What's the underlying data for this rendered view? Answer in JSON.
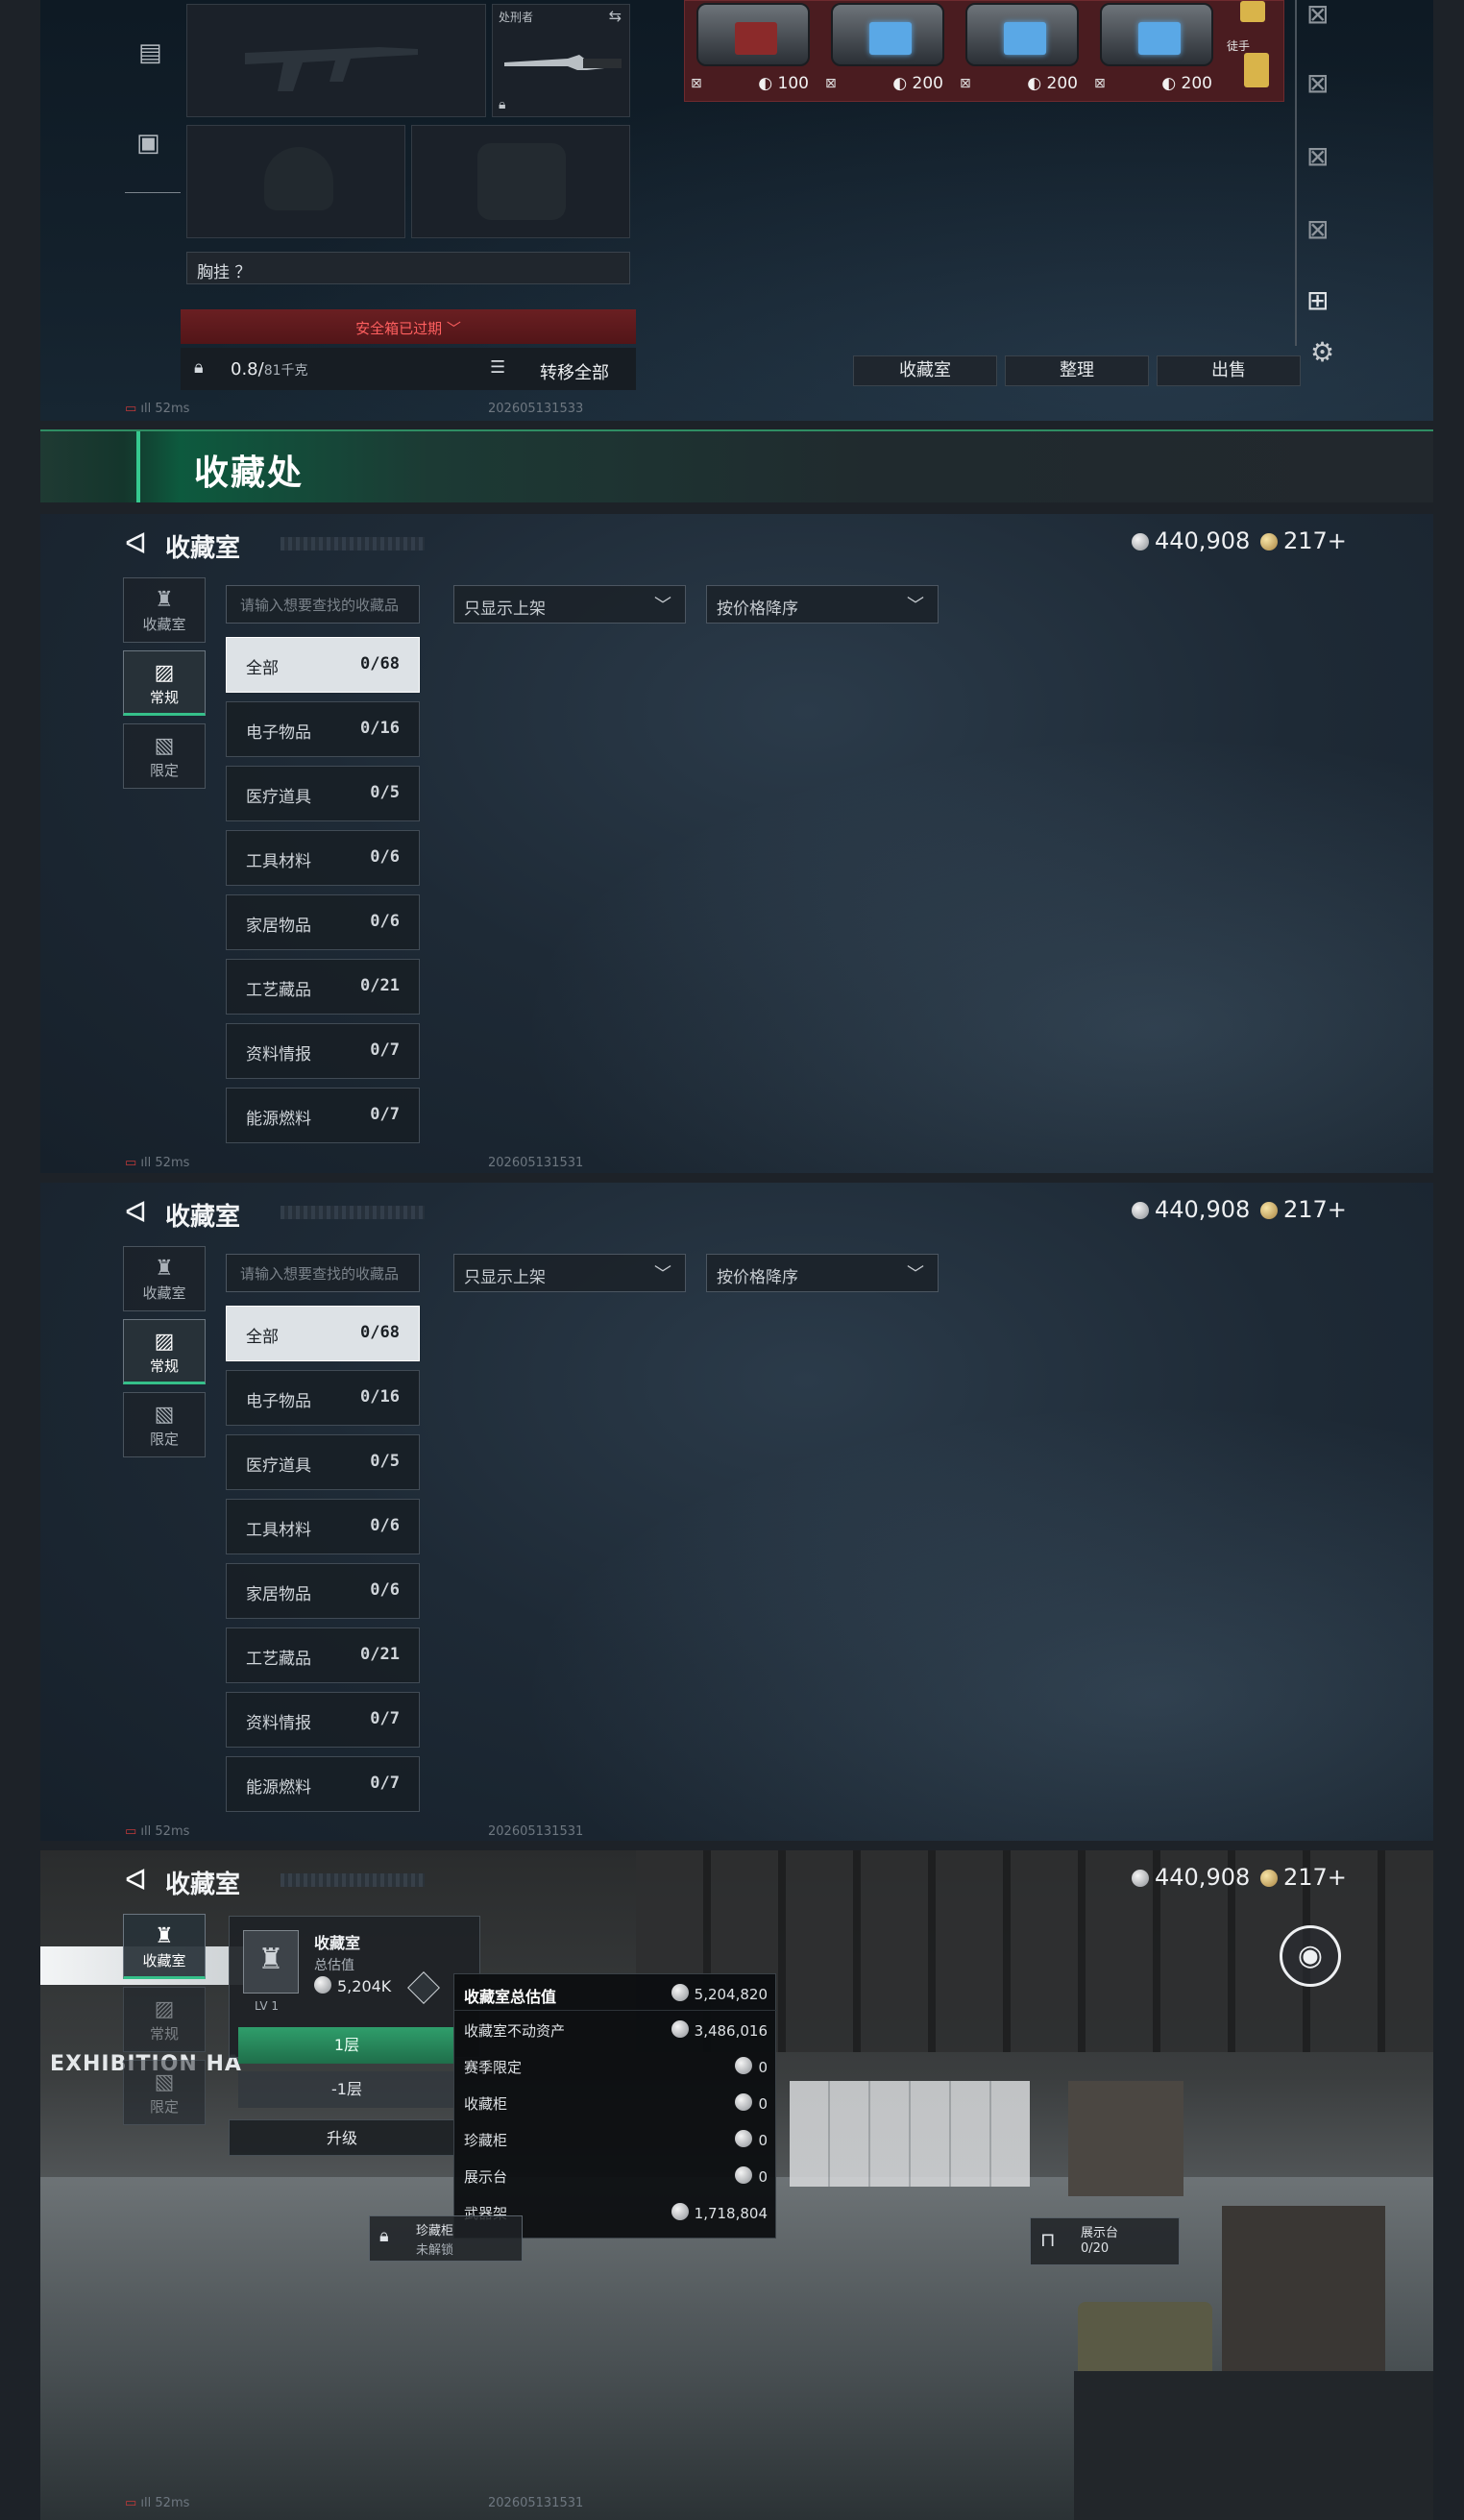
{
  "inventory": {
    "slot_knife_label": "处刑者",
    "chest_hang_label": "胸挂 ？",
    "safebox_warning": "安全箱已过期",
    "weight_value": "0.8/",
    "weight_capacity": "81千克",
    "transfer_all": "转移全部",
    "chests": [
      {
        "value": "100",
        "screen": "red"
      },
      {
        "value": "200",
        "screen": "blue"
      },
      {
        "value": "200",
        "screen": "blue"
      },
      {
        "value": "200",
        "screen": "blue"
      }
    ],
    "extra_label": "徒手",
    "btn_collection_room": "收藏室",
    "btn_arrange": "整理",
    "btn_sell": "出售",
    "ping": "52ms",
    "build_id": "202605131533"
  },
  "banner": {
    "title": "收藏处"
  },
  "collection": {
    "title": "收藏室",
    "currency_silver": "440,908",
    "currency_gold": "217+",
    "rail": [
      {
        "label": "收藏室",
        "icon": "trophy-icon"
      },
      {
        "label": "常规",
        "icon": "image-icon"
      },
      {
        "label": "限定",
        "icon": "picture-icon"
      }
    ],
    "search_placeholder": "请输入想要查找的收藏品",
    "filter_label": "只显示上架",
    "sort_label": "按价格降序",
    "categories": [
      {
        "name": "全部",
        "count": "0/68"
      },
      {
        "name": "电子物品",
        "count": "0/16"
      },
      {
        "name": "医疗道具",
        "count": "0/5"
      },
      {
        "name": "工具材料",
        "count": "0/6"
      },
      {
        "name": "家居物品",
        "count": "0/6"
      },
      {
        "name": "工艺藏品",
        "count": "0/21"
      },
      {
        "name": "资料情报",
        "count": "0/7"
      },
      {
        "name": "能源燃料",
        "count": "0/7"
      }
    ],
    "ping": "52ms",
    "build_id": "202605131531"
  },
  "room": {
    "card_title": "收藏室",
    "card_subtitle": "总估值",
    "card_value": "5,204K",
    "level": "LV 1",
    "floor1": "1层",
    "floor_minus1": "-1层",
    "upgrade": "升级",
    "popup_title": "收藏室总估值",
    "popup_total": "5,204,820",
    "rows": [
      {
        "label": "收藏室不动资产",
        "value": "3,486,016"
      },
      {
        "label": "赛季限定",
        "value": "0"
      },
      {
        "label": "收藏柜",
        "value": "0"
      },
      {
        "label": "珍藏柜",
        "value": "0"
      },
      {
        "label": "展示台",
        "value": "0"
      },
      {
        "label": "武器架",
        "value": "1,718,804"
      }
    ],
    "wall_text": "EXHIBITION HA",
    "cabinet_label": "珍藏柜",
    "cabinet_status": "未解锁",
    "display_label": "展示台",
    "display_count": "0/20",
    "ping": "52ms",
    "build_id": "202605131531"
  }
}
